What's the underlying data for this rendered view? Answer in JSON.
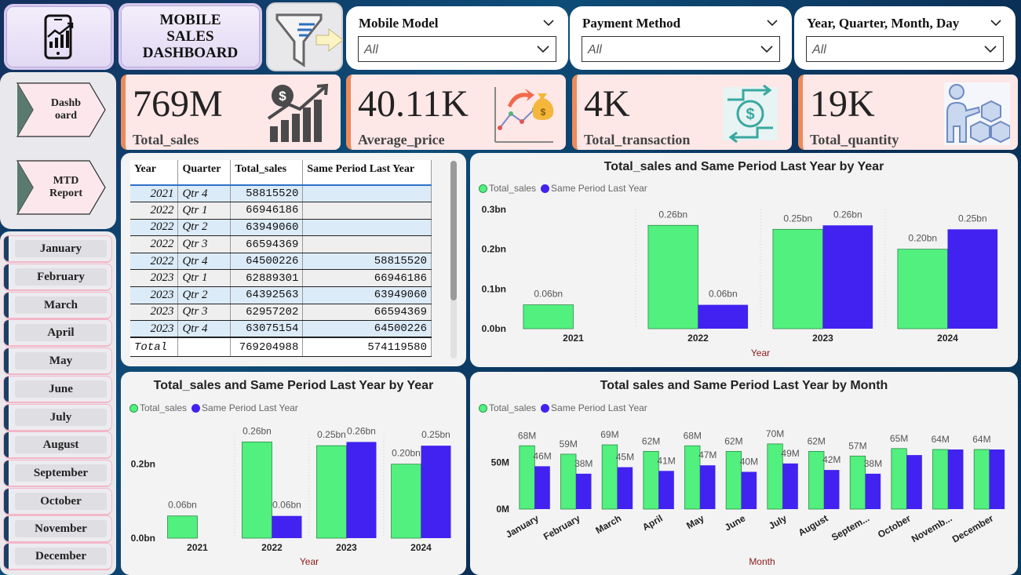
{
  "header": {
    "title": "MOBILE\nSALES\nDASHBOARD",
    "logo_icon": "phone-chart-icon",
    "filter_icon": "funnel-icon"
  },
  "slicers": [
    {
      "title": "Mobile Model",
      "value": "All"
    },
    {
      "title": "Payment Method",
      "value": "All"
    },
    {
      "title": "Year, Quarter, Month, Day",
      "value": "All"
    }
  ],
  "nav": [
    {
      "label": "Dashb\noard"
    },
    {
      "label": "MTD\nReport"
    }
  ],
  "months": [
    "January",
    "February",
    "March",
    "April",
    "May",
    "June",
    "July",
    "August",
    "September",
    "October",
    "November",
    "December"
  ],
  "kpis": [
    {
      "value": "769M",
      "label": "Total_sales",
      "icon": "money-bars-icon"
    },
    {
      "value": "40.11K",
      "label": "Average_price",
      "icon": "moneybag-trend-icon"
    },
    {
      "value": "4K",
      "label": "Total_transaction",
      "icon": "dollar-exchange-icon"
    },
    {
      "value": "19K",
      "label": "Total_quantity",
      "icon": "boxes-person-icon"
    }
  ],
  "table": {
    "headers": [
      "Year",
      "Quarter",
      "Total_sales",
      "Same Period Last Year"
    ],
    "rows": [
      [
        "2021",
        "Qtr 4",
        "58815520",
        ""
      ],
      [
        "2022",
        "Qtr 1",
        "66946186",
        ""
      ],
      [
        "2022",
        "Qtr 2",
        "63949060",
        ""
      ],
      [
        "2022",
        "Qtr 3",
        "66594369",
        ""
      ],
      [
        "2022",
        "Qtr 4",
        "64500226",
        "58815520"
      ],
      [
        "2023",
        "Qtr 1",
        "62889301",
        "66946186"
      ],
      [
        "2023",
        "Qtr 2",
        "64392563",
        "63949060"
      ],
      [
        "2023",
        "Qtr 3",
        "62957202",
        "66594369"
      ],
      [
        "2023",
        "Qtr 4",
        "63075154",
        "64500226"
      ]
    ],
    "total": [
      "Total",
      "",
      "769204988",
      "574119580"
    ]
  },
  "colors": {
    "total_sales": "#52f07e",
    "same_period": "#4222f0"
  },
  "legend": {
    "series1": "Total_sales",
    "series2": "Same Period Last Year"
  },
  "chart_data": [
    {
      "type": "bar",
      "title": "Total_sales and Same Period Last Year by Year",
      "xlabel": "Year",
      "categories": [
        "2021",
        "2022",
        "2023",
        "2024"
      ],
      "series": [
        {
          "name": "Total_sales",
          "values": [
            0.06,
            0.26,
            0.25,
            0.2
          ],
          "labels": [
            "0.06bn",
            "0.26bn",
            "0.25bn",
            "0.20bn"
          ]
        },
        {
          "name": "Same Period Last Year",
          "values": [
            null,
            0.06,
            0.26,
            0.25
          ],
          "labels": [
            "",
            "0.06bn",
            "0.26bn",
            "0.25bn"
          ]
        }
      ],
      "yticks": [
        "0.0bn",
        "0.1bn",
        "0.2bn",
        "0.3bn"
      ],
      "ylim": [
        0,
        0.3
      ]
    },
    {
      "type": "bar",
      "title": "Total_sales and Same Period Last Year by Year",
      "xlabel": "Year",
      "categories": [
        "2021",
        "2022",
        "2023",
        "2024"
      ],
      "series": [
        {
          "name": "Total_sales",
          "values": [
            0.06,
            0.26,
            0.25,
            0.2
          ],
          "labels": [
            "0.06bn",
            "0.26bn",
            "0.25bn",
            "0.20bn"
          ]
        },
        {
          "name": "Same Period Last Year",
          "values": [
            null,
            0.06,
            0.26,
            0.25
          ],
          "labels": [
            "",
            "0.06bn",
            "0.26bn",
            "0.25bn"
          ]
        }
      ],
      "yticks": [
        "0.0bn",
        "0.2bn"
      ],
      "ylim": [
        0,
        0.28
      ]
    },
    {
      "type": "bar",
      "title": "Total sales and Same Period Last Year by Month",
      "xlabel": "Month",
      "categories": [
        "January",
        "February",
        "March",
        "April",
        "May",
        "June",
        "July",
        "August",
        "Septem...",
        "October",
        "Novemb...",
        "December"
      ],
      "series": [
        {
          "name": "Total_sales",
          "values": [
            68,
            59,
            69,
            62,
            68,
            62,
            70,
            62,
            57,
            65,
            64,
            64
          ],
          "labels": [
            "68M",
            "59M",
            "69M",
            "62M",
            "68M",
            "62M",
            "70M",
            "62M",
            "57M",
            "65M",
            "64M",
            "64M"
          ]
        },
        {
          "name": "Same Period Last Year",
          "values": [
            46,
            38,
            45,
            41,
            47,
            40,
            49,
            42,
            38,
            58,
            64,
            64
          ],
          "labels": [
            "46M",
            "38M",
            "45M",
            "41M",
            "47M",
            "40M",
            "49M",
            "42M",
            "38M",
            "",
            "",
            ""
          ]
        }
      ],
      "yticks": [
        "0M",
        "50M"
      ],
      "ylim": [
        0,
        80
      ]
    }
  ]
}
